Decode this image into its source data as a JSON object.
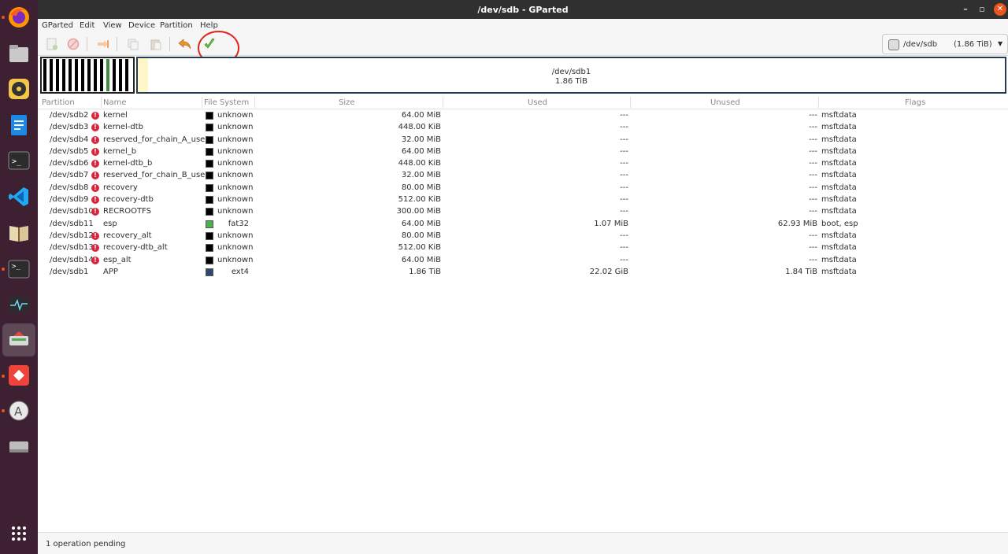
{
  "window": {
    "title": "/dev/sdb - GParted"
  },
  "menu": [
    "GParted",
    "Edit",
    "View",
    "Device",
    "Partition",
    "Help"
  ],
  "toolbar": {
    "buttons": [
      "new-partition",
      "delete",
      "resize-move",
      "copy",
      "paste",
      "undo",
      "apply"
    ],
    "device": {
      "name": "/dev/sdb",
      "size": "(1.86 TiB)"
    }
  },
  "map": {
    "main_partition": "/dev/sdb1",
    "main_size": "1.86 TiB"
  },
  "table": {
    "headers": [
      "Partition",
      "Name",
      "File System",
      "Size",
      "Used",
      "Unused",
      "Flags"
    ],
    "rows": [
      {
        "partition": "/dev/sdb2",
        "warn": true,
        "name": "kernel",
        "fs": "unknown",
        "size": "64.00 MiB",
        "used": "---",
        "unused": "---",
        "flags": "msftdata"
      },
      {
        "partition": "/dev/sdb3",
        "warn": true,
        "name": "kernel-dtb",
        "fs": "unknown",
        "size": "448.00 KiB",
        "used": "---",
        "unused": "---",
        "flags": "msftdata"
      },
      {
        "partition": "/dev/sdb4",
        "warn": true,
        "name": "reserved_for_chain_A_user",
        "fs": "unknown",
        "size": "32.00 MiB",
        "used": "---",
        "unused": "---",
        "flags": "msftdata"
      },
      {
        "partition": "/dev/sdb5",
        "warn": true,
        "name": "kernel_b",
        "fs": "unknown",
        "size": "64.00 MiB",
        "used": "---",
        "unused": "---",
        "flags": "msftdata"
      },
      {
        "partition": "/dev/sdb6",
        "warn": true,
        "name": "kernel-dtb_b",
        "fs": "unknown",
        "size": "448.00 KiB",
        "used": "---",
        "unused": "---",
        "flags": "msftdata"
      },
      {
        "partition": "/dev/sdb7",
        "warn": true,
        "name": "reserved_for_chain_B_user",
        "fs": "unknown",
        "size": "32.00 MiB",
        "used": "---",
        "unused": "---",
        "flags": "msftdata"
      },
      {
        "partition": "/dev/sdb8",
        "warn": true,
        "name": "recovery",
        "fs": "unknown",
        "size": "80.00 MiB",
        "used": "---",
        "unused": "---",
        "flags": "msftdata"
      },
      {
        "partition": "/dev/sdb9",
        "warn": true,
        "name": "recovery-dtb",
        "fs": "unknown",
        "size": "512.00 KiB",
        "used": "---",
        "unused": "---",
        "flags": "msftdata"
      },
      {
        "partition": "/dev/sdb10",
        "warn": true,
        "name": "RECROOTFS",
        "fs": "unknown",
        "size": "300.00 MiB",
        "used": "---",
        "unused": "---",
        "flags": "msftdata"
      },
      {
        "partition": "/dev/sdb11",
        "warn": false,
        "name": "esp",
        "fs": "fat32",
        "size": "64.00 MiB",
        "used": "1.07 MiB",
        "unused": "62.93 MiB",
        "flags": "boot, esp",
        "color": "#4caf50"
      },
      {
        "partition": "/dev/sdb12",
        "warn": true,
        "name": "recovery_alt",
        "fs": "unknown",
        "size": "80.00 MiB",
        "used": "---",
        "unused": "---",
        "flags": "msftdata"
      },
      {
        "partition": "/dev/sdb13",
        "warn": true,
        "name": "recovery-dtb_alt",
        "fs": "unknown",
        "size": "512.00 KiB",
        "used": "---",
        "unused": "---",
        "flags": "msftdata"
      },
      {
        "partition": "/dev/sdb14",
        "warn": true,
        "name": "esp_alt",
        "fs": "unknown",
        "size": "64.00 MiB",
        "used": "---",
        "unused": "---",
        "flags": "msftdata"
      },
      {
        "partition": "/dev/sdb1",
        "warn": false,
        "name": "APP",
        "fs": "ext4",
        "size": "1.86 TiB",
        "used": "22.02 GiB",
        "unused": "1.84 TiB",
        "flags": "msftdata",
        "color": "#2e4a6b"
      }
    ]
  },
  "status": {
    "text": "1 operation pending"
  },
  "colors": {
    "dock": "#3d2133",
    "accent": "#e95420",
    "warn": "#d7263d",
    "unknown": "#000000"
  }
}
